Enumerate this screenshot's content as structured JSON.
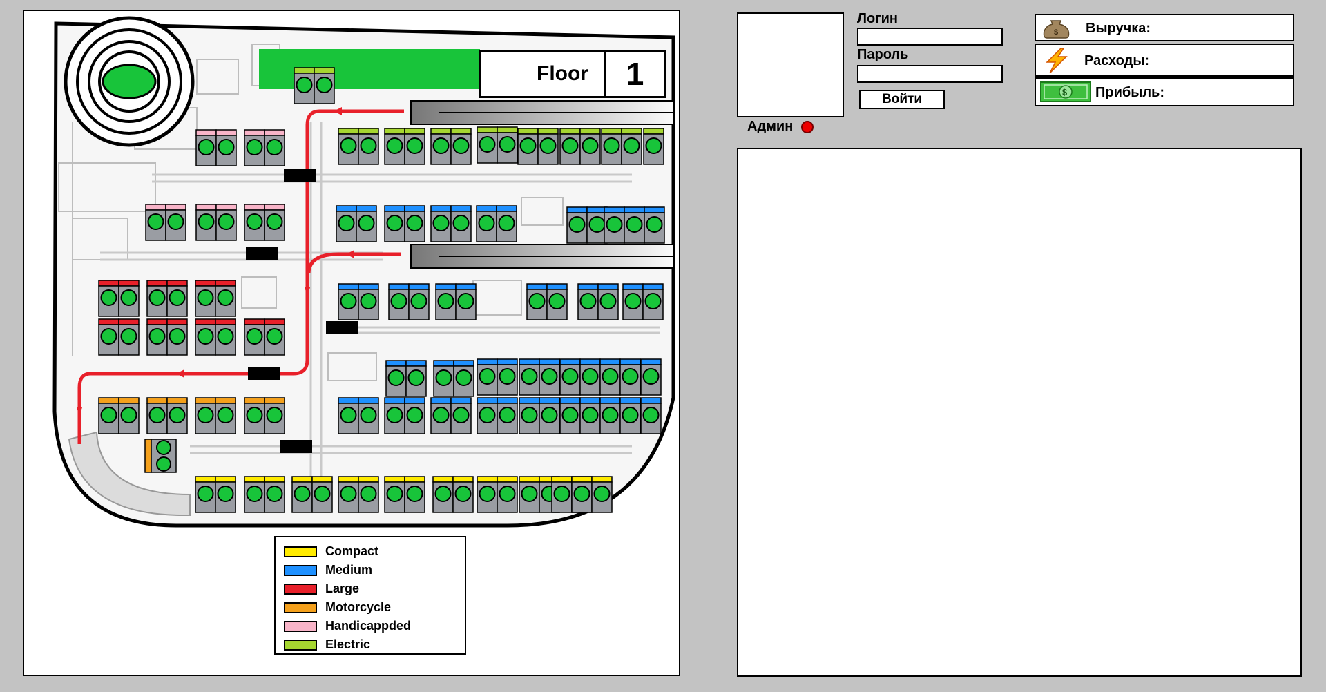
{
  "floor": {
    "label": "Floor",
    "number": "1"
  },
  "legend": [
    {
      "label": "Compact",
      "color": "#ffeb00"
    },
    {
      "label": "Medium",
      "color": "#1e90ff"
    },
    {
      "label": "Large",
      "color": "#e8202a"
    },
    {
      "label": "Motorcycle",
      "color": "#f4a01b"
    },
    {
      "label": "Handicappded",
      "color": "#f8b4c8"
    },
    {
      "label": "Electric",
      "color": "#a6d630"
    }
  ],
  "map": {
    "spot_indicator_color": "#18c43a",
    "route_color": "#e8202a",
    "icons": [
      "ramp-spiral-icon",
      "route-arrow-icon",
      "barrier-icon"
    ]
  },
  "user": {
    "role_label": "Админ",
    "status_color": "#e00000"
  },
  "login_form": {
    "login_label": "Логин",
    "password_label": "Пароль",
    "login_value": "",
    "password_value": "",
    "submit_label": "Войти"
  },
  "finance": {
    "revenue_label": "Выручка:",
    "expenses_label": "Расходы:",
    "profit_label": "Прибыль:",
    "icons": [
      "money-bag-icon",
      "lightning-icon",
      "dollar-bill-icon"
    ]
  }
}
